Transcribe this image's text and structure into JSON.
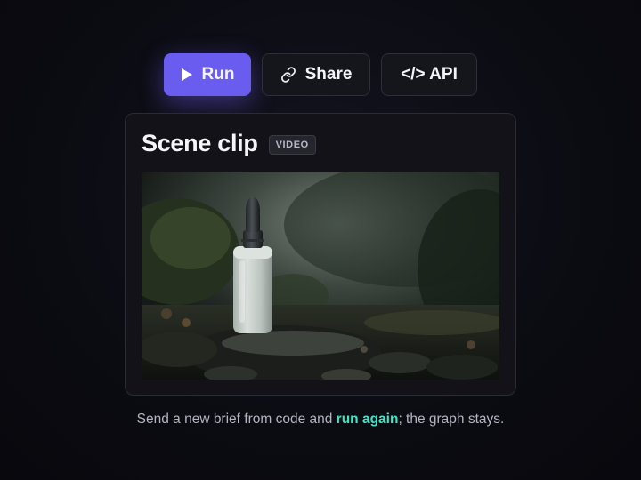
{
  "toolbar": {
    "run_label": "Run",
    "share_label": "Share",
    "api_label": "</> API"
  },
  "card": {
    "title": "Scene clip",
    "badge": "VIDEO",
    "media_alt": "Frosted glass dropper bottle on a wet mossy rock in a misty forest"
  },
  "caption": {
    "before": "Send a new brief from code and ",
    "highlight": "run again",
    "after": "; the graph stays."
  },
  "colors": {
    "accent": "#6b5cf0",
    "highlight": "#3ee6c5",
    "background": "#0b0b12"
  },
  "icons": {
    "run": "play-icon",
    "share": "link-icon"
  }
}
